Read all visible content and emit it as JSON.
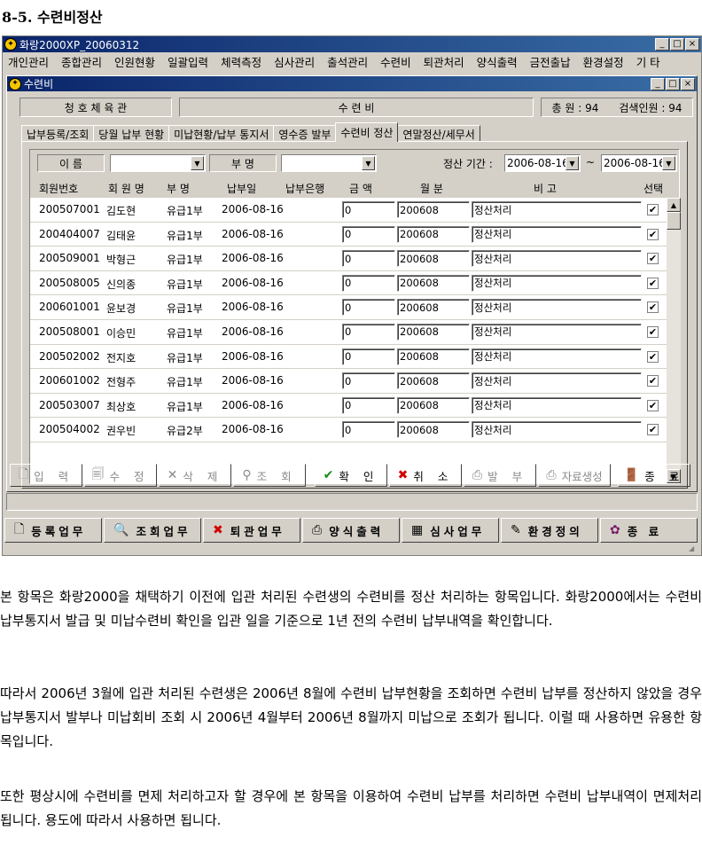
{
  "doc_heading": "8-5. 수련비정산",
  "app": {
    "title": "화랑2000XP_20060312",
    "menu": [
      "개인관리",
      "종합관리",
      "인원현황",
      "일괄입력",
      "체력측정",
      "심사관리",
      "출석관리",
      "수련비",
      "퇴관처리",
      "양식출력",
      "금전출납",
      "환경설정",
      "기 타"
    ]
  },
  "child": {
    "title": "수련비",
    "gym_name": "청 호 체 육 관",
    "module_name": "수 련 비",
    "total_label": "총 원 : 94",
    "search_label": "검색인원 : 94",
    "tabs": [
      "납부등록/조회",
      "당월 납부 현황",
      "미납현황/납부 통지서",
      "영수증 발부",
      "수련비 정산",
      "연말정산/세무서"
    ],
    "filter": {
      "name_label": "이 름",
      "name_value": "",
      "dept_label": "부 명",
      "dept_value": "",
      "period_label": "정산 기간 :",
      "date_from": "2006-08-16",
      "tilde": "~",
      "date_to": "2006-08-16"
    },
    "columns": [
      "회원번호",
      "회 원 명",
      "부  명",
      "납부일",
      "납부은행",
      "금  액",
      "월 분",
      "비   고",
      "선택"
    ],
    "rows": [
      {
        "id": "200507001",
        "name": "김도현",
        "dept": "유급1부",
        "date": "2006-08-16",
        "bank": "",
        "amount": "0",
        "month": "200608",
        "note": "정산처리",
        "check": "✔"
      },
      {
        "id": "200404007",
        "name": "김태윤",
        "dept": "유급1부",
        "date": "2006-08-16",
        "bank": "",
        "amount": "0",
        "month": "200608",
        "note": "정산처리",
        "check": "✔"
      },
      {
        "id": "200509001",
        "name": "박형근",
        "dept": "유급1부",
        "date": "2006-08-16",
        "bank": "",
        "amount": "0",
        "month": "200608",
        "note": "정산처리",
        "check": "✔"
      },
      {
        "id": "200508005",
        "name": "신의종",
        "dept": "유급1부",
        "date": "2006-08-16",
        "bank": "",
        "amount": "0",
        "month": "200608",
        "note": "정산처리",
        "check": "✔"
      },
      {
        "id": "200601001",
        "name": "윤보경",
        "dept": "유급1부",
        "date": "2006-08-16",
        "bank": "",
        "amount": "0",
        "month": "200608",
        "note": "정산처리",
        "check": "✔"
      },
      {
        "id": "200508001",
        "name": "이승민",
        "dept": "유급1부",
        "date": "2006-08-16",
        "bank": "",
        "amount": "0",
        "month": "200608",
        "note": "정산처리",
        "check": "✔"
      },
      {
        "id": "200502002",
        "name": "전지호",
        "dept": "유급1부",
        "date": "2006-08-16",
        "bank": "",
        "amount": "0",
        "month": "200608",
        "note": "정산처리",
        "check": "✔"
      },
      {
        "id": "200601002",
        "name": "전형주",
        "dept": "유급1부",
        "date": "2006-08-16",
        "bank": "",
        "amount": "0",
        "month": "200608",
        "note": "정산처리",
        "check": "✔"
      },
      {
        "id": "200503007",
        "name": "최상호",
        "dept": "유급1부",
        "date": "2006-08-16",
        "bank": "",
        "amount": "0",
        "month": "200608",
        "note": "정산처리",
        "check": "✔"
      },
      {
        "id": "200504002",
        "name": "권우빈",
        "dept": "유급2부",
        "date": "2006-08-16",
        "bank": "",
        "amount": "0",
        "month": "200608",
        "note": "정산처리",
        "check": "✔"
      }
    ],
    "actions": {
      "input": "입 력",
      "edit": "수 정",
      "delete": "삭 제",
      "query": "조 회",
      "confirm": "확 인",
      "cancel": "취 소",
      "issue": "발 부",
      "export": "자료생성",
      "exit": "종 료"
    }
  },
  "bottom_toolbar": {
    "register": "등록업무",
    "lookup": "조회업무",
    "retire": "퇴관업무",
    "print": "양식출력",
    "exam": "심사업무",
    "settings": "환경정의",
    "exit": "종 료"
  },
  "paragraphs": [
    "본 항목은 화랑2000을 채택하기 이전에 입관 처리된 수련생의 수련비를 정산 처리하는 항목입니다. 화랑2000에서는 수련비 납부통지서 발급 및 미납수련비 확인을 입관 일을 기준으로 1년 전의 수련비 납부내역을 확인합니다.",
    "따라서 2006년 3월에 입관 처리된 수련생은 2006년 8월에 수련비 납부현황을 조회하면 수련비 납부를 정산하지 않았을 경우 납부통지서 발부나 미납회비 조회 시 2006년 4월부터 2006년 8월까지 미납으로 조회가 됩니다. 이럴 때 사용하면 유용한 항목입니다.",
    "또한 평상시에 수련비를 면제 처리하고자 할 경우에 본 항목을 이용하여 수련비 납부를 처리하면 수련비 납부내역이 면제처리 됩니다. 용도에 따라서 사용하면 됩니다."
  ]
}
